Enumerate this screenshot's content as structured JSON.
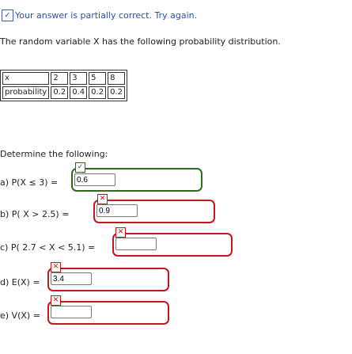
{
  "feedback": {
    "icon": "partial-credit-icon",
    "message": "Your answer is partially correct.  Try again."
  },
  "intro": "The random variable X has the following probability distribution.",
  "table": {
    "row_x_label": "x",
    "x_values": [
      "2",
      "3",
      "5",
      "8"
    ],
    "row_p_label": "probability",
    "p_values": [
      "0.2",
      "0.4",
      "0.2",
      "0.2"
    ]
  },
  "instruction": "Determine the following:",
  "questions": [
    {
      "label": "a) P(X ≤ 3) =",
      "value": "0.6",
      "status": "correct"
    },
    {
      "label": "b) P( X > 2.5) =",
      "value": "0.9",
      "status": "incorrect"
    },
    {
      "label": "c) P( 2.7 < X < 5.1) =",
      "value": "",
      "status": "incorrect"
    },
    {
      "label": "d) E(X) =",
      "value": "3.4",
      "status": "incorrect"
    },
    {
      "label": "e) V(X) =",
      "value": "",
      "status": "incorrect"
    }
  ],
  "colors": {
    "correct": "#2e6b1e",
    "incorrect": "#c4161c",
    "feedback": "#2b50a0"
  }
}
